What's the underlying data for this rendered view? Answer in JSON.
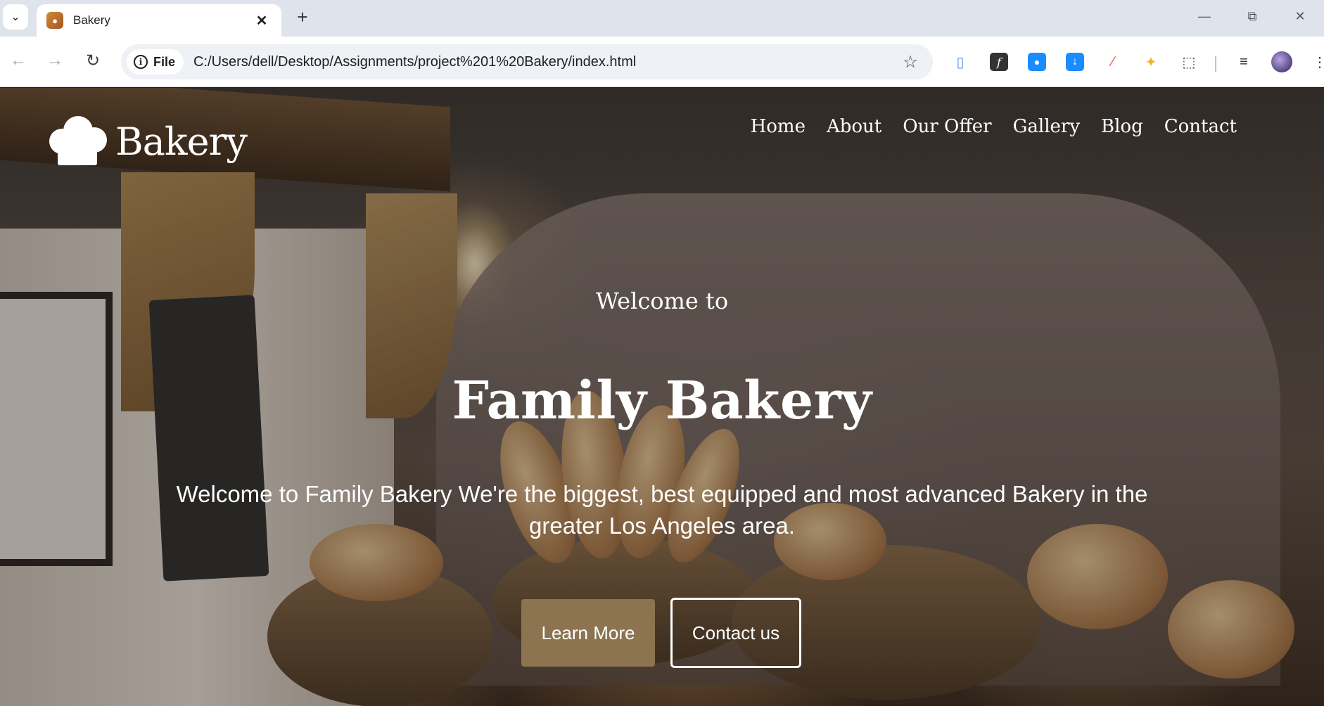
{
  "browser": {
    "tab": {
      "title": "Bakery",
      "favicon": "bakery-favicon"
    },
    "url_chip": "File",
    "url": "C:/Users/dell/Desktop/Assignments/project%201%20Bakery/index.html",
    "icons": {
      "tab_menu": "chevron-down-icon",
      "close": "close-icon",
      "new_tab": "plus-icon",
      "back": "back-arrow-icon",
      "forward": "forward-arrow-icon",
      "reload": "reload-icon",
      "info": "info-icon",
      "bookmark": "star-icon"
    },
    "extensions": [
      "device-extension-icon",
      "fonts-extension-icon",
      "color-picker-extension-icon",
      "download-extension-icon",
      "eyedropper-extension-icon",
      "highlighter-extension-icon",
      "puzzle-extensions-icon",
      "media-control-icon",
      "profile-avatar-icon",
      "more-menu-icon"
    ]
  },
  "site": {
    "brand": "Bakery",
    "nav": [
      "Home",
      "About",
      "Our Offer",
      "Gallery",
      "Blog",
      "Contact"
    ],
    "hero": {
      "welcome": "Welcome to",
      "headline": "Family Bakery",
      "tagline": "Welcome to Family Bakery We're the biggest, best equipped and most advanced Bakery in the greater Los Angeles area.",
      "primary_button": "Learn More",
      "secondary_button": "Contact us"
    }
  },
  "colors": {
    "primary_button": "#8c7450",
    "tabstrip": "#dfe3ec",
    "text_light": "#ffffff"
  }
}
